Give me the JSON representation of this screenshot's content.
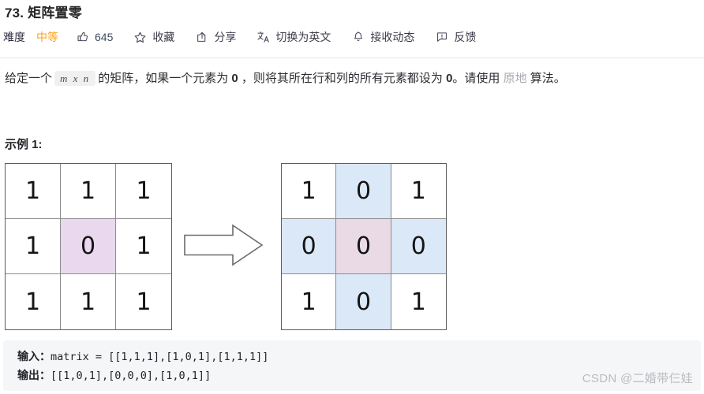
{
  "page": {
    "title": "73. 矩阵置零"
  },
  "toolbar": {
    "difficulty_label": "难度",
    "difficulty_value": "中等",
    "like_count": "645",
    "items": [
      {
        "icon": "thumbs-up-icon",
        "label": "645"
      },
      {
        "icon": "star-icon",
        "label": "收藏"
      },
      {
        "icon": "share-icon",
        "label": "分享"
      },
      {
        "icon": "translate-icon",
        "label": "切换为英文"
      },
      {
        "icon": "bell-icon",
        "label": "接收动态"
      },
      {
        "icon": "feedback-icon",
        "label": "反馈"
      }
    ]
  },
  "description": {
    "part1": "给定一个",
    "code": "m x n",
    "part2": "的矩阵，如果一个元素为",
    "zero1": "0",
    "part3": "，则将其所在行和列的所有元素都设为",
    "zero2": "0",
    "part4": "。请使用",
    "link": "原地",
    "part5": "算法。"
  },
  "example": {
    "heading": "示例 1:"
  },
  "chart_data": {
    "type": "table",
    "title": "示例 1 矩阵转换示意",
    "matrices": [
      {
        "name": "input-matrix",
        "values": [
          [
            1,
            1,
            1
          ],
          [
            1,
            0,
            1
          ],
          [
            1,
            1,
            1
          ]
        ],
        "highlights": [
          {
            "row": 1,
            "col": 1,
            "color": "#ead9ee",
            "kind": "purple"
          }
        ]
      },
      {
        "name": "output-matrix",
        "values": [
          [
            1,
            0,
            1
          ],
          [
            0,
            0,
            0
          ],
          [
            1,
            0,
            1
          ]
        ],
        "highlights": [
          {
            "row": 0,
            "col": 1,
            "color": "#dbe8f8",
            "kind": "blue"
          },
          {
            "row": 1,
            "col": 0,
            "color": "#dbe8f8",
            "kind": "blue"
          },
          {
            "row": 1,
            "col": 1,
            "color": "#eadae6",
            "kind": "pink"
          },
          {
            "row": 1,
            "col": 2,
            "color": "#dbe8f8",
            "kind": "blue"
          },
          {
            "row": 2,
            "col": 1,
            "color": "#dbe8f8",
            "kind": "blue"
          }
        ]
      }
    ],
    "arrow": "right-arrow"
  },
  "io": {
    "input_key": "输入：",
    "input_value": "matrix = [[1,1,1],[1,0,1],[1,1,1]]",
    "output_key": "输出：",
    "output_value": "[[1,0,1],[0,0,0],[1,0,1]]"
  },
  "watermark": {
    "text": "CSDN @二婚带仨娃"
  },
  "colors": {
    "difficulty_medium": "#ffa116",
    "highlight_purple": "#ead9ee",
    "highlight_blue": "#dbe8f8",
    "highlight_pink": "#eadae6",
    "code_bg": "#f5f6f7"
  }
}
